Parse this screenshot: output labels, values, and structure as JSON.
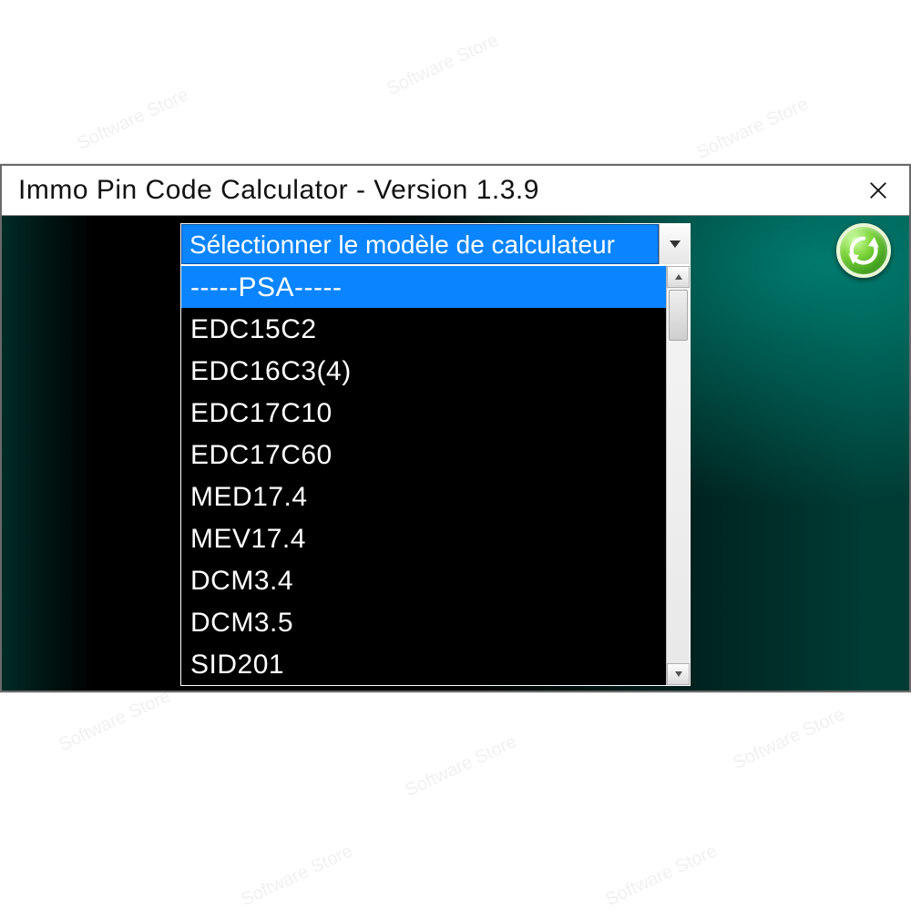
{
  "watermark_text": "Software Store",
  "window": {
    "title": "Immo Pin Code Calculator  -  Version 1.3.9"
  },
  "combo": {
    "placeholder": "Sélectionner le modèle de calculateur"
  },
  "dropdown": {
    "selected_index": 0,
    "items": [
      "-----PSA-----",
      "EDC15C2",
      "EDC16C3(4)",
      "EDC17C10",
      "EDC17C60",
      "MED17.4",
      "MEV17.4",
      "DCM3.4",
      "DCM3.5",
      "SID201"
    ]
  }
}
